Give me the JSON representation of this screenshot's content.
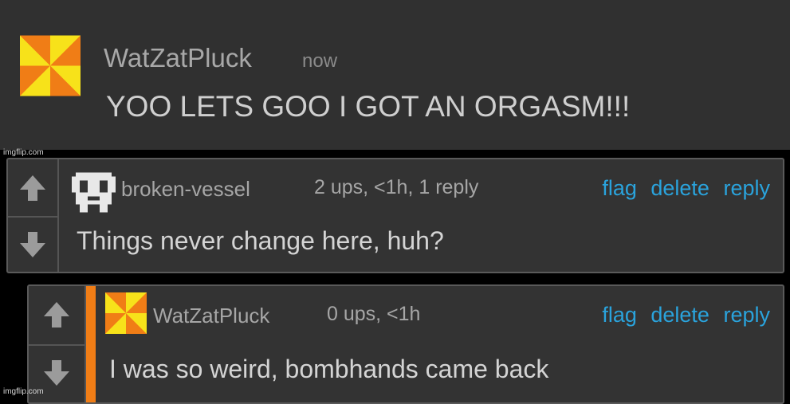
{
  "top_message": {
    "username": "WatZatPluck",
    "time": "now",
    "text": "YOO LETS GOO I GOT AN ORGASM!!!"
  },
  "watermark": "imgflip.com",
  "comments": [
    {
      "username": "broken-vessel",
      "meta": "2 ups, <1h, 1 reply",
      "actions": [
        "flag",
        "delete",
        "reply"
      ],
      "text": "Things never change here, huh?"
    },
    {
      "username": "WatZatPluck",
      "meta": "0 ups, <1h",
      "actions": [
        "flag",
        "delete",
        "reply"
      ],
      "text": "I was so weird, bombhands came back"
    }
  ],
  "colors": {
    "link": "#2aa3dc",
    "reply_bar": "#f07d16",
    "avatar_orange": "#f07d16",
    "avatar_yellow": "#f7e21a"
  },
  "icons": [
    "pinwheel-avatar-icon",
    "pixel-mask-avatar-icon",
    "upvote-arrow-icon",
    "downvote-arrow-icon"
  ]
}
